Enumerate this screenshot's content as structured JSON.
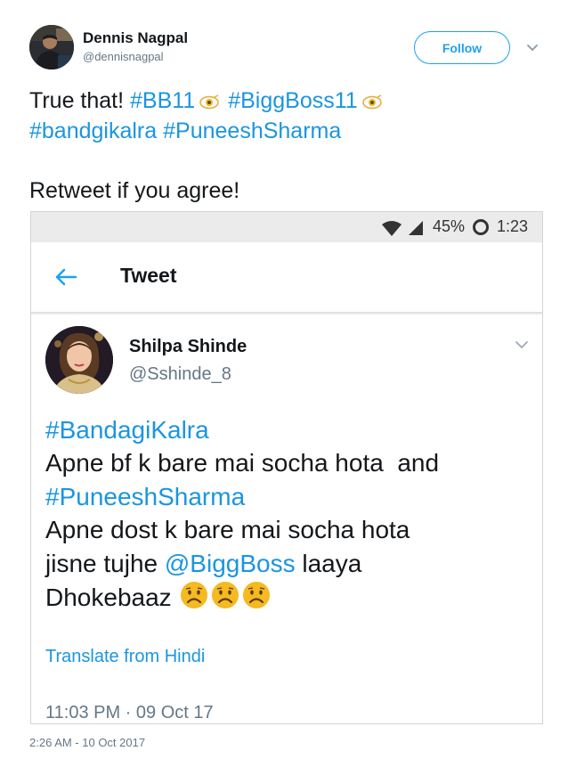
{
  "tweet": {
    "author_name": "Dennis Nagpal",
    "author_handle": "@dennisnagpal",
    "follow_label": "Follow",
    "text_prefix": "True that!",
    "hashtags_line1": [
      "#BB11",
      "#BiggBoss11"
    ],
    "hashtags_line2": [
      "#bandgikalra",
      "#PuneeshSharma"
    ],
    "text_line3": "Retweet if you agree!",
    "timestamp": "2:26 AM - 10 Oct 2017",
    "icons": [
      "chevron-down-icon",
      "eyes-emoji-icon"
    ]
  },
  "screenshot": {
    "status_bar": {
      "battery": "45%",
      "time": "1:23",
      "icons": [
        "wifi-icon",
        "signal-icon",
        "loading-ring-icon"
      ]
    },
    "app_bar": {
      "title": "Tweet",
      "icons": [
        "back-arrow-icon"
      ]
    },
    "tweet": {
      "author_name": "Shilpa Shinde",
      "author_handle": "@Sshinde_8",
      "hashtag1": "#BandagiKalra",
      "line2": "Apne bf k bare mai socha hota  and",
      "hashtag2": "#PuneeshSharma",
      "line4": "Apne dost k bare mai socha hota",
      "line5_prefix": "jisne tujhe",
      "mention": "@BiggBoss",
      "line5_suffix": "laaya",
      "line6": "Dhokebaaz",
      "translate": "Translate from Hindi",
      "timestamp": "11:03 PM · 09 Oct 17",
      "icons": [
        "chevron-down-icon",
        "frowning-face-emoji-icon"
      ]
    }
  },
  "colors": {
    "link_blue": "#1b95e0",
    "twitter_blue": "#1da1f2",
    "secondary_gray": "#657786",
    "text_dark": "#14171a",
    "status_bar_bg": "#ebebeb",
    "emoji_yellow": "#f5b921"
  }
}
